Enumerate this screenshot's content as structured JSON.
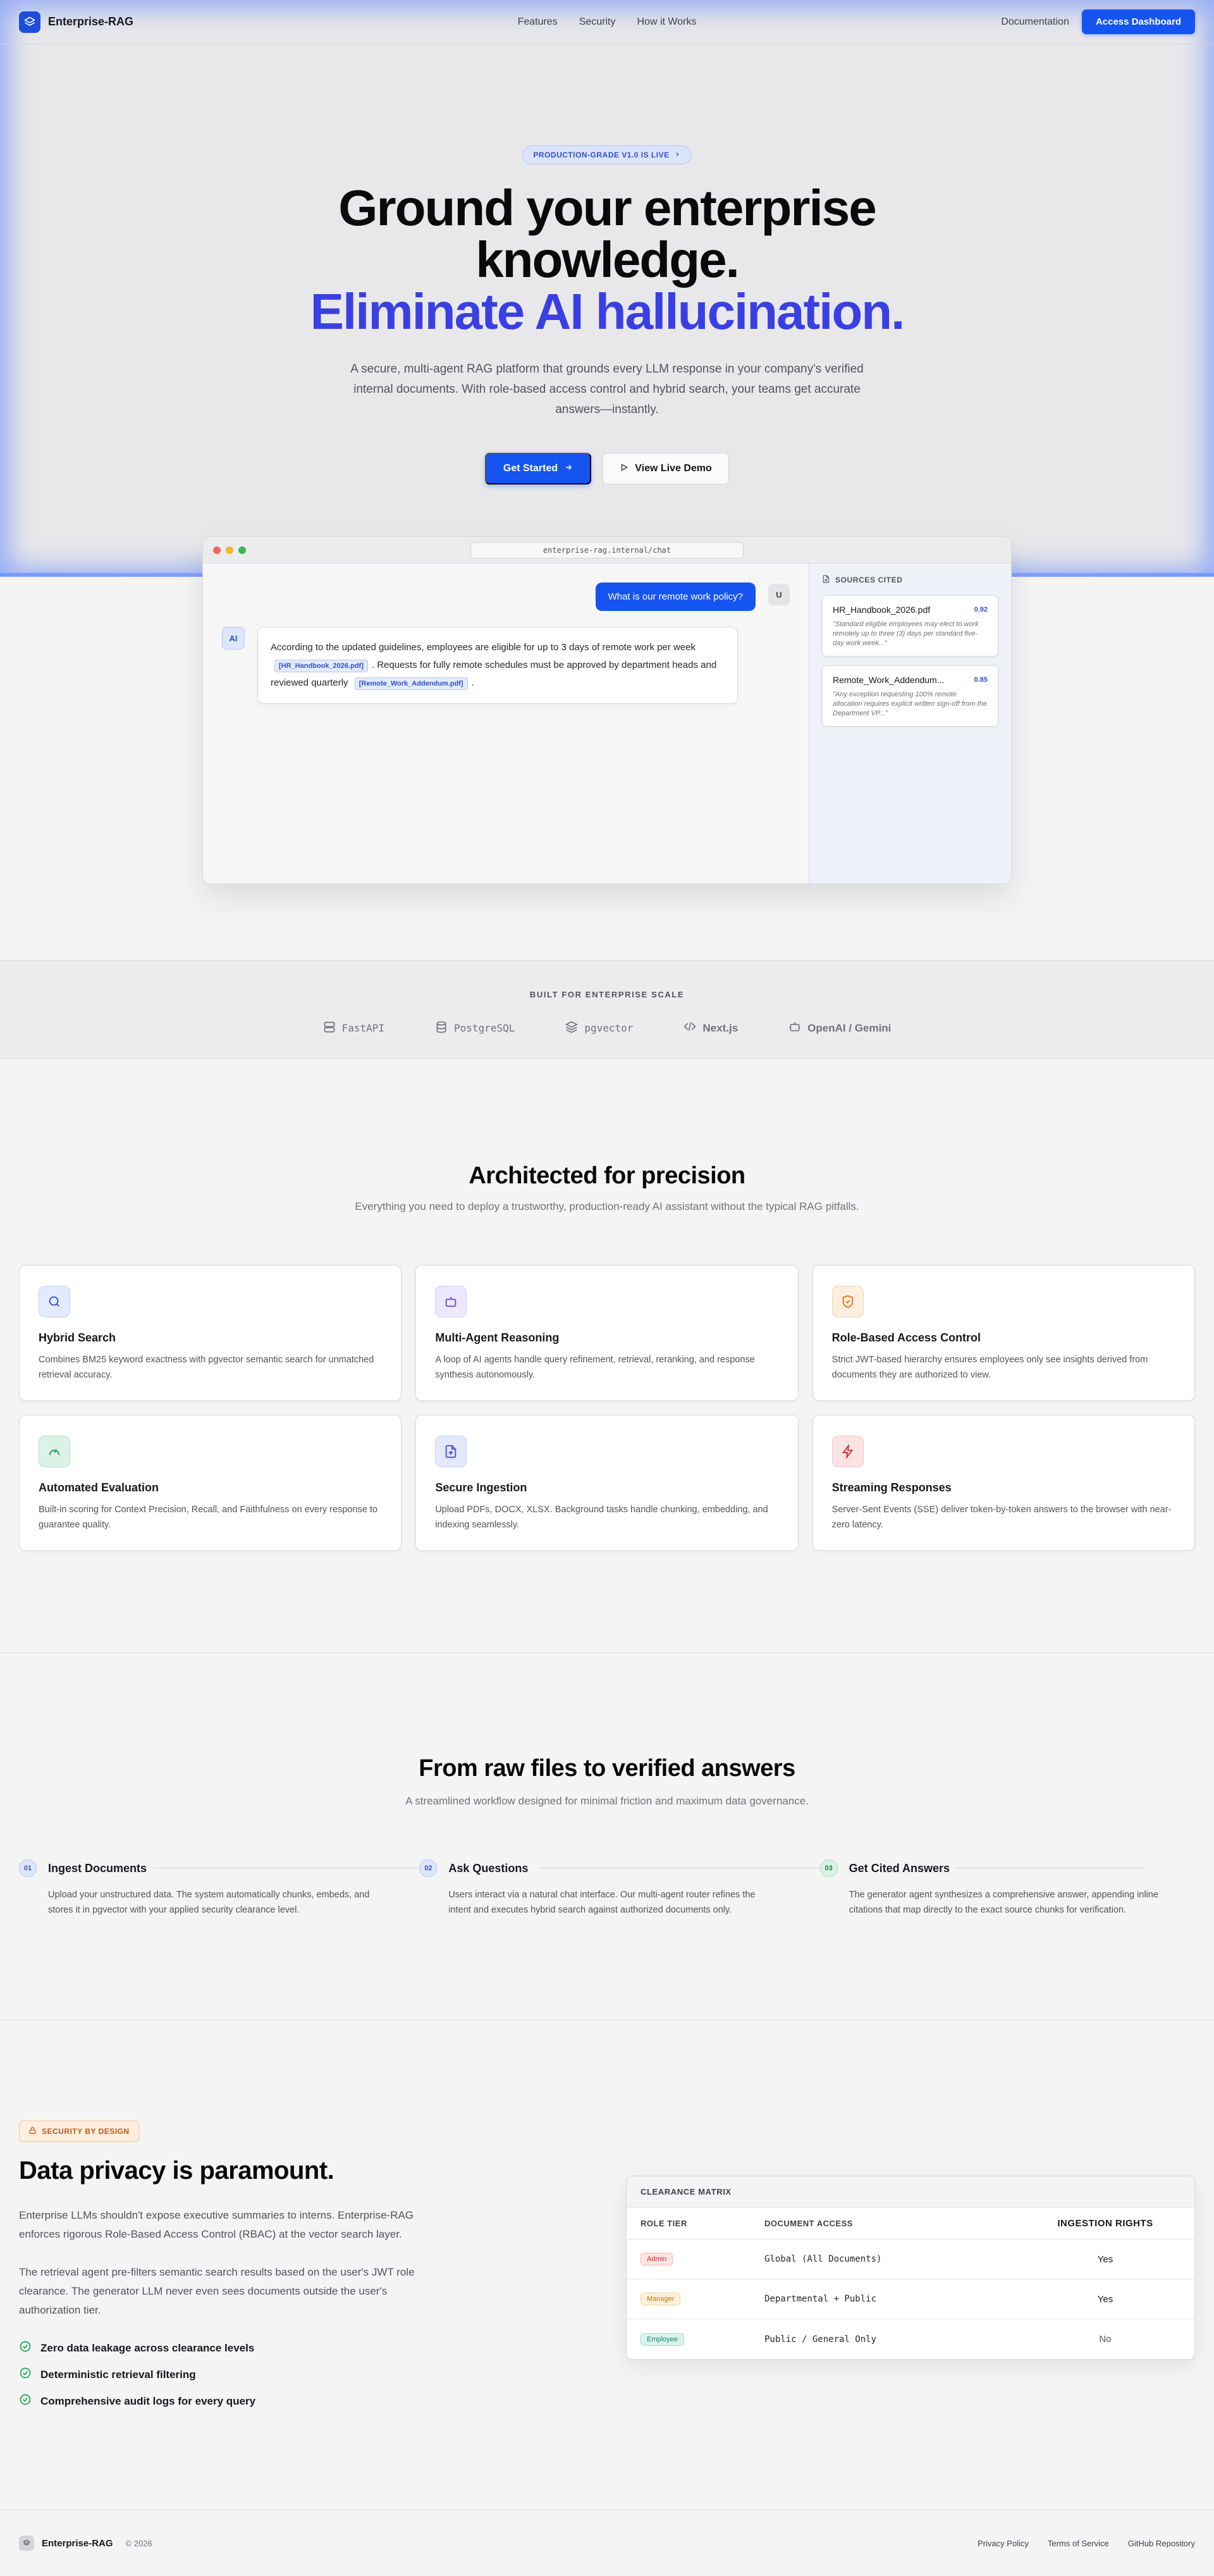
{
  "nav": {
    "brand": "Enterprise-RAG",
    "links": [
      "Features",
      "Security",
      "How it Works"
    ],
    "documentation": "Documentation",
    "access_dashboard": "Access Dashboard"
  },
  "hero": {
    "badge": "PRODUCTION-GRADE V1.0 IS LIVE",
    "title_line1": "Ground your enterprise",
    "title_line2": "knowledge.",
    "title_accent": "Eliminate AI hallucination.",
    "subtitle": "A secure, multi-agent RAG platform that grounds every LLM response in your company's verified internal documents. With role-based access control and hybrid search, your teams get accurate answers—instantly.",
    "cta_primary": "Get Started",
    "cta_secondary": "View Live Demo"
  },
  "demo": {
    "url": "enterprise-rag.internal/chat",
    "user_question": "What is our remote work policy?",
    "user_avatar": "U",
    "ai_avatar": "AI",
    "answer_part1": "According to the updated guidelines, employees are eligible for up to 3 days of remote work per week",
    "citation1": "[HR_Handbook_2026.pdf]",
    "answer_part2": ". Requests for fully remote schedules must be approved by department heads and reviewed quarterly",
    "citation2": "[Remote_Work_Addendum.pdf]",
    "answer_part3": ".",
    "sources_title": "SOURCES CITED",
    "sources": [
      {
        "name": "HR_Handbook_2026.pdf",
        "score": "0.92",
        "quote": "\"Standard eligible employees may elect to work remotely up to three (3) days per standard five-day work week...\""
      },
      {
        "name": "Remote_Work_Addendum...",
        "score": "0.85",
        "quote": "\"Any exception requesting 100% remote allocation requires explicit written sign-off from the Department VP...\""
      }
    ],
    "colors": {
      "dot_red": "#ef6a5a",
      "dot_yellow": "#f2b632",
      "dot_green": "#3bb55b"
    }
  },
  "built": {
    "title": "BUILT FOR ENTERPRISE SCALE",
    "techs": [
      "FastAPI",
      "PostgreSQL",
      "pgvector",
      "Next.js",
      "OpenAI / Gemini"
    ]
  },
  "features": {
    "title": "Architected for precision",
    "subtitle": "Everything you need to deploy a trustworthy, production-ready AI assistant without the typical RAG pitfalls.",
    "items": [
      {
        "title": "Hybrid Search",
        "desc": "Combines BM25 keyword exactness with pgvector semantic search for unmatched retrieval accuracy.",
        "icon": "search-icon"
      },
      {
        "title": "Multi-Agent Reasoning",
        "desc": "A loop of AI agents handle query refinement, retrieval, reranking, and response synthesis autonomously.",
        "icon": "bot-icon"
      },
      {
        "title": "Role-Based Access Control",
        "desc": "Strict JWT-based hierarchy ensures employees only see insights derived from documents they are authorized to view.",
        "icon": "shield-check-icon"
      },
      {
        "title": "Automated Evaluation",
        "desc": "Built-in scoring for Context Precision, Recall, and Faithfulness on every response to guarantee quality.",
        "icon": "gauge-icon"
      },
      {
        "title": "Secure Ingestion",
        "desc": "Upload PDFs, DOCX, XLSX. Background tasks handle chunking, embedding, and indexing seamlessly.",
        "icon": "file-upload-icon"
      },
      {
        "title": "Streaming Responses",
        "desc": "Server-Sent Events (SSE) deliver token-by-token answers to the browser with near-zero latency.",
        "icon": "zap-icon"
      }
    ]
  },
  "workflow": {
    "title": "From raw files to verified answers",
    "subtitle": "A streamlined workflow designed for minimal friction and maximum data governance.",
    "steps": [
      {
        "num": "01",
        "title": "Ingest Documents",
        "desc": "Upload your unstructured data. The system automatically chunks, embeds, and stores it in pgvector with your applied security clearance level."
      },
      {
        "num": "02",
        "title": "Ask Questions",
        "desc": "Users interact via a natural chat interface. Our multi-agent router refines the intent and executes hybrid search against authorized documents only."
      },
      {
        "num": "03",
        "title": "Get Cited Answers",
        "desc": "The generator agent synthesizes a comprehensive answer, appending inline citations that map directly to the exact source chunks for verification."
      }
    ]
  },
  "security": {
    "badge": "SECURITY BY DESIGN",
    "title": "Data privacy is paramount.",
    "p1": "Enterprise LLMs shouldn't expose executive summaries to interns. Enterprise-RAG enforces rigorous Role-Based Access Control (RBAC) at the vector search layer.",
    "p2": "The retrieval agent pre-filters semantic search results based on the user's JWT role clearance. The generator LLM never even sees documents outside the user's authorization tier.",
    "checks": [
      "Zero data leakage across clearance levels",
      "Deterministic retrieval filtering",
      "Comprehensive audit logs for every query"
    ],
    "matrix": {
      "title": "CLEARANCE MATRIX",
      "headers": [
        "ROLE TIER",
        "DOCUMENT ACCESS",
        "INGESTION RIGHTS"
      ],
      "rows": [
        {
          "role": "Admin",
          "access": "Global (All Documents)",
          "rights": "Yes"
        },
        {
          "role": "Manager",
          "access": "Departmental + Public",
          "rights": "Yes"
        },
        {
          "role": "Employee",
          "access": "Public / General Only",
          "rights": "No"
        }
      ]
    }
  },
  "footer": {
    "brand": "Enterprise-RAG",
    "copyright": "© 2026",
    "links": [
      "Privacy Policy",
      "Terms of Service",
      "GitHub Repository"
    ]
  }
}
